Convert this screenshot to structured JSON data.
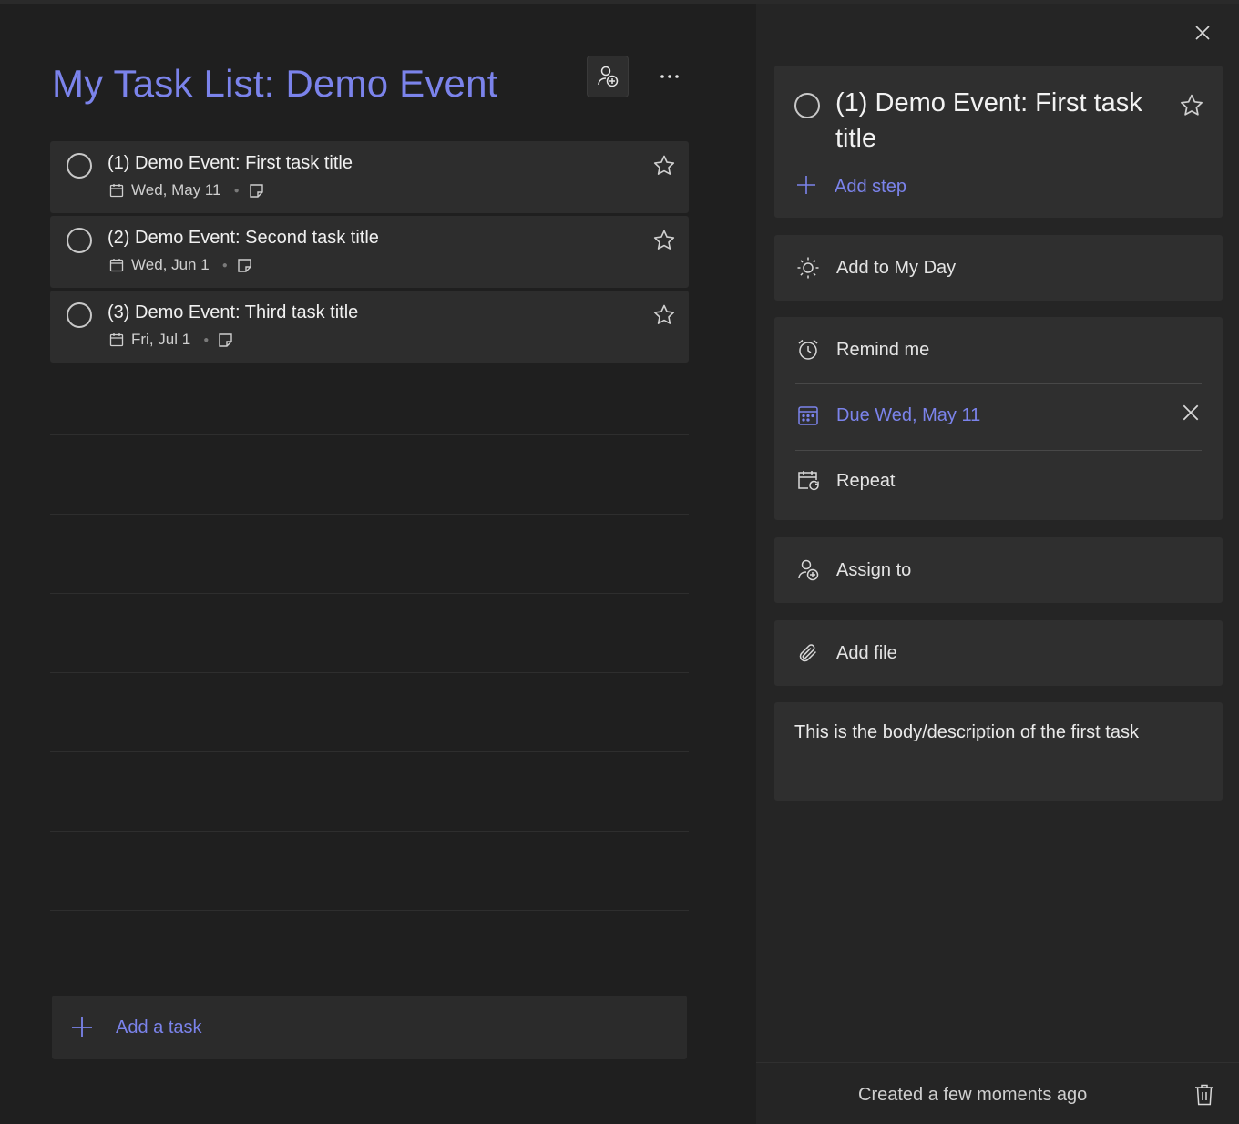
{
  "list": {
    "title": "My Task List: Demo Event",
    "assign_icon": "assign-person-add-icon",
    "more_icon": "more-horizontal-icon",
    "tasks": [
      {
        "title": "(1) Demo Event: First task title",
        "due": "Wed, May 11"
      },
      {
        "title": "(2) Demo Event: Second task title",
        "due": "Wed, Jun 1"
      },
      {
        "title": "(3) Demo Event: Third task title",
        "due": "Fri, Jul 1"
      }
    ],
    "add_task_label": "Add a task"
  },
  "detail": {
    "title": "(1) Demo Event: First task title",
    "add_step_label": "Add step",
    "add_to_my_day_label": "Add to My Day",
    "remind_me_label": "Remind me",
    "due_label": "Due Wed, May 11",
    "repeat_label": "Repeat",
    "assign_to_label": "Assign to",
    "add_file_label": "Add file",
    "note": "This is the body/description of the first task",
    "created": "Created a few moments ago"
  },
  "colors": {
    "accent": "#7b83eb",
    "background": "#1f1f1f",
    "card": "#2d2d2d",
    "panel": "#252525"
  }
}
